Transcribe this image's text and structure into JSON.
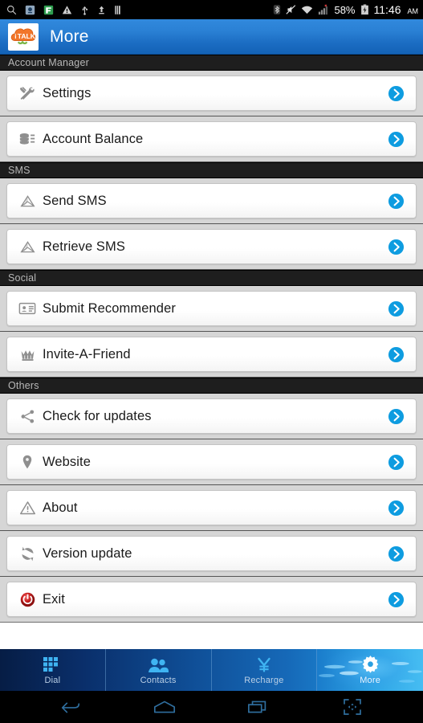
{
  "statusbar": {
    "left_icons": [
      "search-icon",
      "app-update-icon",
      "app-green-icon",
      "warning-icon",
      "usb-icon",
      "upload-icon",
      "sim-icon"
    ],
    "right_icons": [
      "bluetooth-icon",
      "mute-icon",
      "wifi-icon",
      "signal-icon"
    ],
    "battery_percent": "58%",
    "battery_icon": "battery-icon",
    "time": "11:46",
    "ampm": "AM"
  },
  "actionbar": {
    "logo_name": "italk-logo",
    "logo_text": "iTALK",
    "title": "More"
  },
  "sections": [
    {
      "header": "Account Manager",
      "items": [
        {
          "label": "Settings",
          "icon": "tools-icon"
        },
        {
          "label": "Account Balance",
          "icon": "coins-icon"
        }
      ]
    },
    {
      "header": "SMS",
      "items": [
        {
          "label": "Send SMS",
          "icon": "send-sms-icon"
        },
        {
          "label": "Retrieve SMS",
          "icon": "retrieve-sms-icon"
        }
      ]
    },
    {
      "header": "Social",
      "items": [
        {
          "label": "Submit Recommender",
          "icon": "id-card-icon"
        },
        {
          "label": "Invite-A-Friend",
          "icon": "crown-icon"
        }
      ]
    },
    {
      "header": "Others",
      "items": [
        {
          "label": "Check for updates",
          "icon": "share-icon"
        },
        {
          "label": "Website",
          "icon": "map-pin-icon"
        },
        {
          "label": "About",
          "icon": "warning-triangle-icon"
        },
        {
          "label": "Version update",
          "icon": "refresh-icon"
        },
        {
          "label": "Exit",
          "icon": "power-icon"
        }
      ]
    }
  ],
  "row_chevron_icon": "chevron-right-circle-icon",
  "tabs": [
    {
      "label": "Dial",
      "icon": "keypad-icon",
      "active": false
    },
    {
      "label": "Contacts",
      "icon": "contacts-icon",
      "active": false
    },
    {
      "label": "Recharge",
      "icon": "yen-icon",
      "active": false
    },
    {
      "label": "More",
      "icon": "gear-icon",
      "active": true
    }
  ],
  "navbar": [
    {
      "icon": "back-icon"
    },
    {
      "icon": "home-icon"
    },
    {
      "icon": "recents-icon"
    },
    {
      "icon": "screenshot-icon"
    }
  ],
  "colors": {
    "accent_blue": "#0e9ce0",
    "header_blue": "#2a80d4",
    "page_bg": "#d6d6d6",
    "section_bg": "#1e1e1e",
    "exit_red": "#cc2222"
  }
}
